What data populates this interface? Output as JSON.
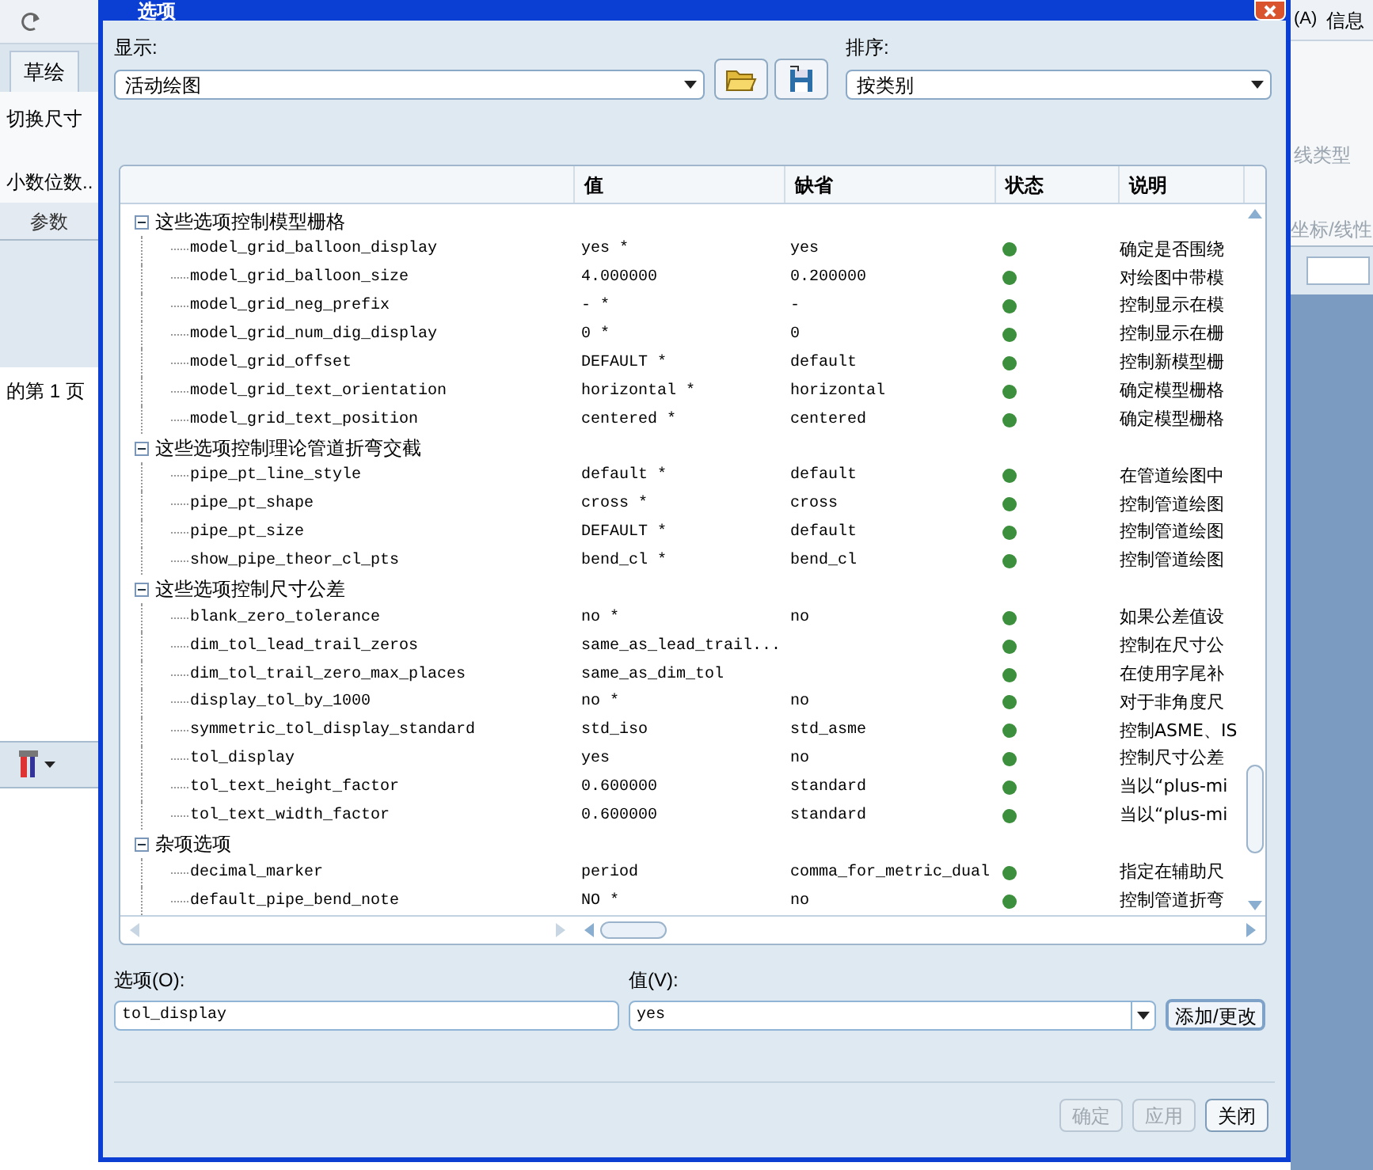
{
  "background_app": {
    "left_texts": [
      "草绘",
      "切换尺寸",
      "小数位数..",
      "参数",
      "的第 1 页"
    ],
    "right_texts": [
      "(A)",
      "信息",
      "线类型",
      "坐标/线性"
    ]
  },
  "window": {
    "title": "选项"
  },
  "display": {
    "label": "显示:",
    "value": "活动绘图"
  },
  "sort": {
    "label": "排序:",
    "value": "按类别"
  },
  "table": {
    "columns": [
      "值",
      "缺省",
      "状态",
      "说明"
    ],
    "groups": [
      {
        "title": "这些选项控制模型栅格",
        "expanded": true,
        "rows": [
          {
            "name": "model_grid_balloon_display",
            "value": "yes *",
            "default": "yes",
            "color": "#3c8f3c",
            "desc": "确定是否围绕"
          },
          {
            "name": "model_grid_balloon_size",
            "value": "4.000000",
            "default": "0.200000",
            "color": "#3c8f3c",
            "desc": "对绘图中带模"
          },
          {
            "name": "model_grid_neg_prefix",
            "value": "- *",
            "default": "-",
            "color": "#3c8f3c",
            "desc": "控制显示在模"
          },
          {
            "name": "model_grid_num_dig_display",
            "value": "0 *",
            "default": "0",
            "color": "#3c8f3c",
            "desc": "控制显示在栅"
          },
          {
            "name": "model_grid_offset",
            "value": "DEFAULT *",
            "default": "default",
            "color": "#3c8f3c",
            "desc": "控制新模型栅"
          },
          {
            "name": "model_grid_text_orientation",
            "value": "horizontal *",
            "default": "horizontal",
            "color": "#3c8f3c",
            "desc": "确定模型栅格"
          },
          {
            "name": "model_grid_text_position",
            "value": "centered *",
            "default": "centered",
            "color": "#3c8f3c",
            "desc": "确定模型栅格"
          }
        ]
      },
      {
        "title": "这些选项控制理论管道折弯交截",
        "expanded": true,
        "rows": [
          {
            "name": "pipe_pt_line_style",
            "value": "default *",
            "default": "default",
            "color": "#3c8f3c",
            "desc": "在管道绘图中"
          },
          {
            "name": "pipe_pt_shape",
            "value": "cross *",
            "default": "cross",
            "color": "#3c8f3c",
            "desc": "控制管道绘图"
          },
          {
            "name": "pipe_pt_size",
            "value": "DEFAULT *",
            "default": "default",
            "color": "#3c8f3c",
            "desc": "控制管道绘图"
          },
          {
            "name": "show_pipe_theor_cl_pts",
            "value": "bend_cl *",
            "default": "bend_cl",
            "color": "#3c8f3c",
            "desc": "控制管道绘图"
          }
        ]
      },
      {
        "title": "这些选项控制尺寸公差",
        "expanded": true,
        "rows": [
          {
            "name": "blank_zero_tolerance",
            "value": "no *",
            "default": "no",
            "color": "#3c8f3c",
            "desc": "如果公差值设"
          },
          {
            "name": "dim_tol_lead_trail_zeros",
            "value": "same_as_lead_trail...",
            "color": "#3c8f3c",
            "desc": "控制在尺寸公"
          },
          {
            "name": "dim_tol_trail_zero_max_places",
            "value": "same_as_dim_tol",
            "color": "#3c8f3c",
            "desc": "在使用字尾补"
          },
          {
            "name": "display_tol_by_1000",
            "value": "no *",
            "default": "no",
            "color": "#3c8f3c",
            "desc": "对于非角度尺"
          },
          {
            "name": "symmetric_tol_display_standard",
            "value": "std_iso",
            "default": "std_asme",
            "color": "#3c8f3c",
            "desc": "控制ASME、IS"
          },
          {
            "name": "tol_display",
            "value": "yes",
            "default": "no",
            "color": "#3c8f3c",
            "desc": "控制尺寸公差"
          },
          {
            "name": "tol_text_height_factor",
            "value": "0.600000",
            "default": "standard",
            "color": "#3c8f3c",
            "desc": "当以“plus-mi"
          },
          {
            "name": "tol_text_width_factor",
            "value": "0.600000",
            "default": "standard",
            "color": "#3c8f3c",
            "desc": "当以“plus-mi"
          }
        ]
      },
      {
        "title": "杂项选项",
        "expanded": true,
        "rows": [
          {
            "name": "decimal_marker",
            "value": "period",
            "default": "comma_for_metric_dual",
            "color": "#3c8f3c",
            "desc": "指定在辅助尺"
          },
          {
            "name": "default_pipe_bend_note",
            "value": "NO *",
            "default": "no",
            "color": "#3c8f3c",
            "desc": "控制管道折弯"
          }
        ]
      }
    ]
  },
  "option_field": {
    "label": "选项(O):",
    "value": "tol_display"
  },
  "value_field": {
    "label": "值(V):",
    "value": "yes"
  },
  "add_button": "添加/更改",
  "buttons": [
    {
      "label": "确定",
      "disabled": true
    },
    {
      "label": "应用",
      "disabled": true
    },
    {
      "label": "关闭",
      "disabled": false
    }
  ]
}
